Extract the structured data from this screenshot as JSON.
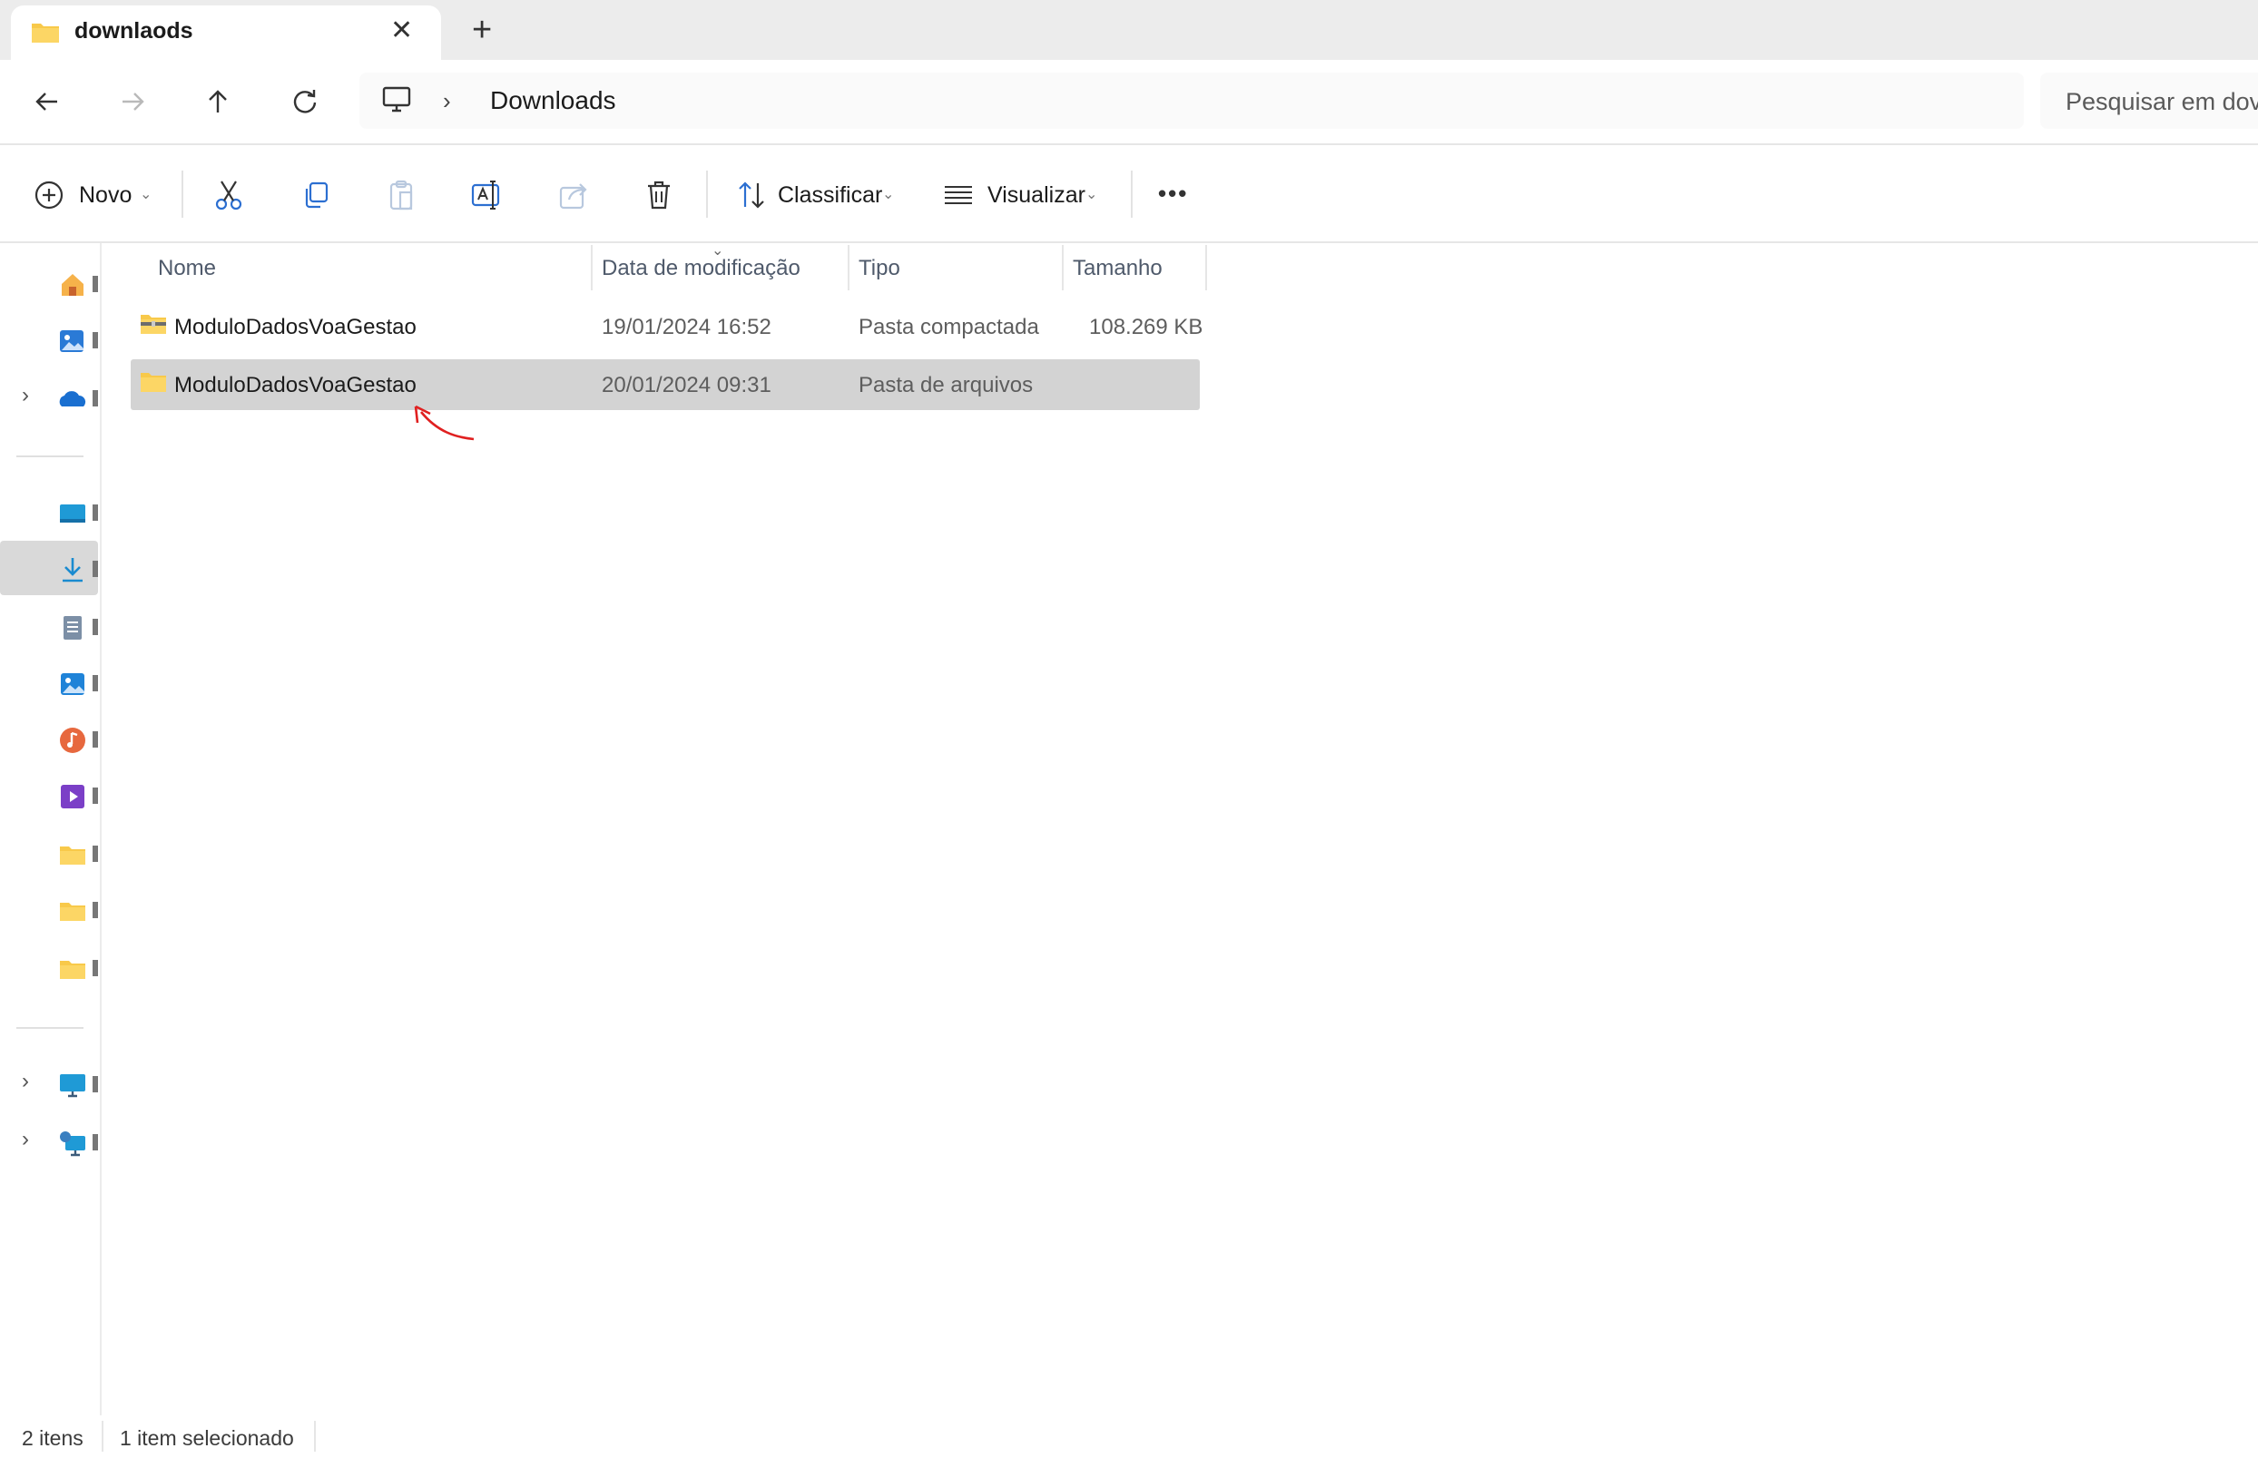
{
  "tab": {
    "title": "downlaods",
    "close_icon": "close-icon",
    "new_tab_icon": "plus-icon"
  },
  "nav": {
    "back_icon": "arrow-left-icon",
    "forward_icon": "arrow-right-icon",
    "up_icon": "arrow-up-icon",
    "refresh_icon": "refresh-icon"
  },
  "address": {
    "root_icon": "this-pc-icon",
    "chevron": "›",
    "current": "Downloads"
  },
  "search": {
    "placeholder": "Pesquisar em dov"
  },
  "toolbar": {
    "new_label": "Novo",
    "sort_label": "Classificar",
    "view_label": "Visualizar",
    "more_label": "•••"
  },
  "columns": {
    "name": "Nome",
    "date": "Data de modificação",
    "type": "Tipo",
    "size": "Tamanho"
  },
  "files": [
    {
      "name": "ModuloDadosVoaGestao",
      "date": "19/01/2024 16:52",
      "type": "Pasta compactada",
      "size": "108.269 KB",
      "icon": "zip-folder-icon"
    },
    {
      "name": "ModuloDadosVoaGestao",
      "date": "20/01/2024 09:31",
      "type": "Pasta de arquivos",
      "size": "",
      "icon": "folder-icon"
    }
  ],
  "status": {
    "count": "2 itens",
    "selected": "1 item selecionado"
  },
  "colors": {
    "selected_row": "#d3d3d3",
    "folder": "#f8c94a",
    "annotation_arrow": "#e02020"
  }
}
